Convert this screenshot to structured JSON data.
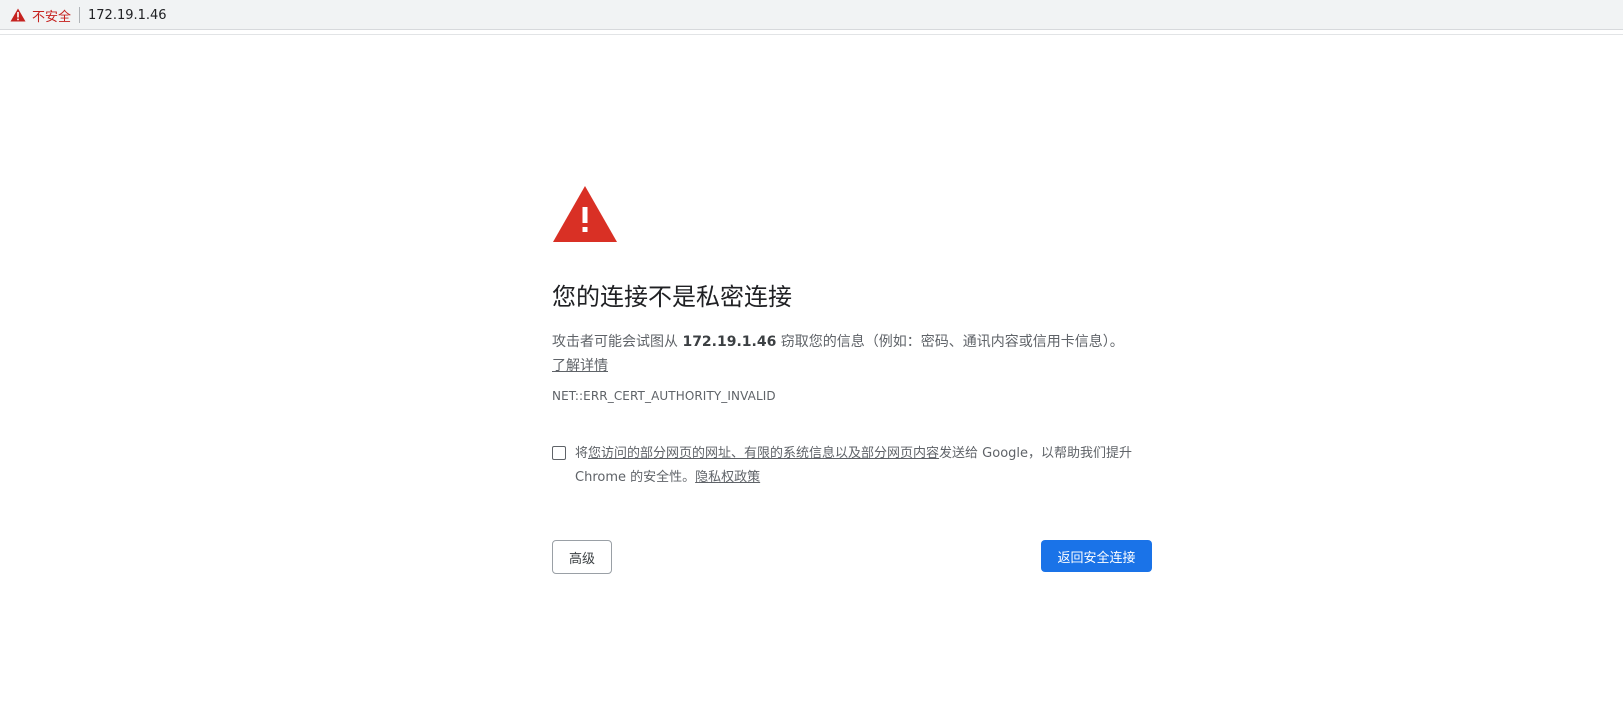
{
  "addressbar": {
    "security_label": "不安全",
    "url": "172.19.1.46"
  },
  "interstitial": {
    "title": "您的连接不是私密连接",
    "desc_prefix": "攻击者可能会试图从 ",
    "desc_host": "172.19.1.46",
    "desc_suffix": " 窃取您的信息（例如：密码、通讯内容或信用卡信息）。",
    "learn_more": "了解详情",
    "error_code": "NET::ERR_CERT_AUTHORITY_INVALID",
    "optin_prefix": "将",
    "optin_link": "您访问的部分网页的网址、有限的系统信息以及部分网页内容",
    "optin_mid": "发送给 Google，以帮助我们提升 Chrome 的安全性。",
    "privacy_policy": "隐私权政策",
    "advanced_button": "高级",
    "back_button": "返回安全连接"
  },
  "colors": {
    "warning_red": "#d93025",
    "primary_blue": "#1a73e8"
  },
  "icons": {
    "address_warning": "warning-triangle-icon",
    "main_warning": "warning-triangle-icon"
  }
}
